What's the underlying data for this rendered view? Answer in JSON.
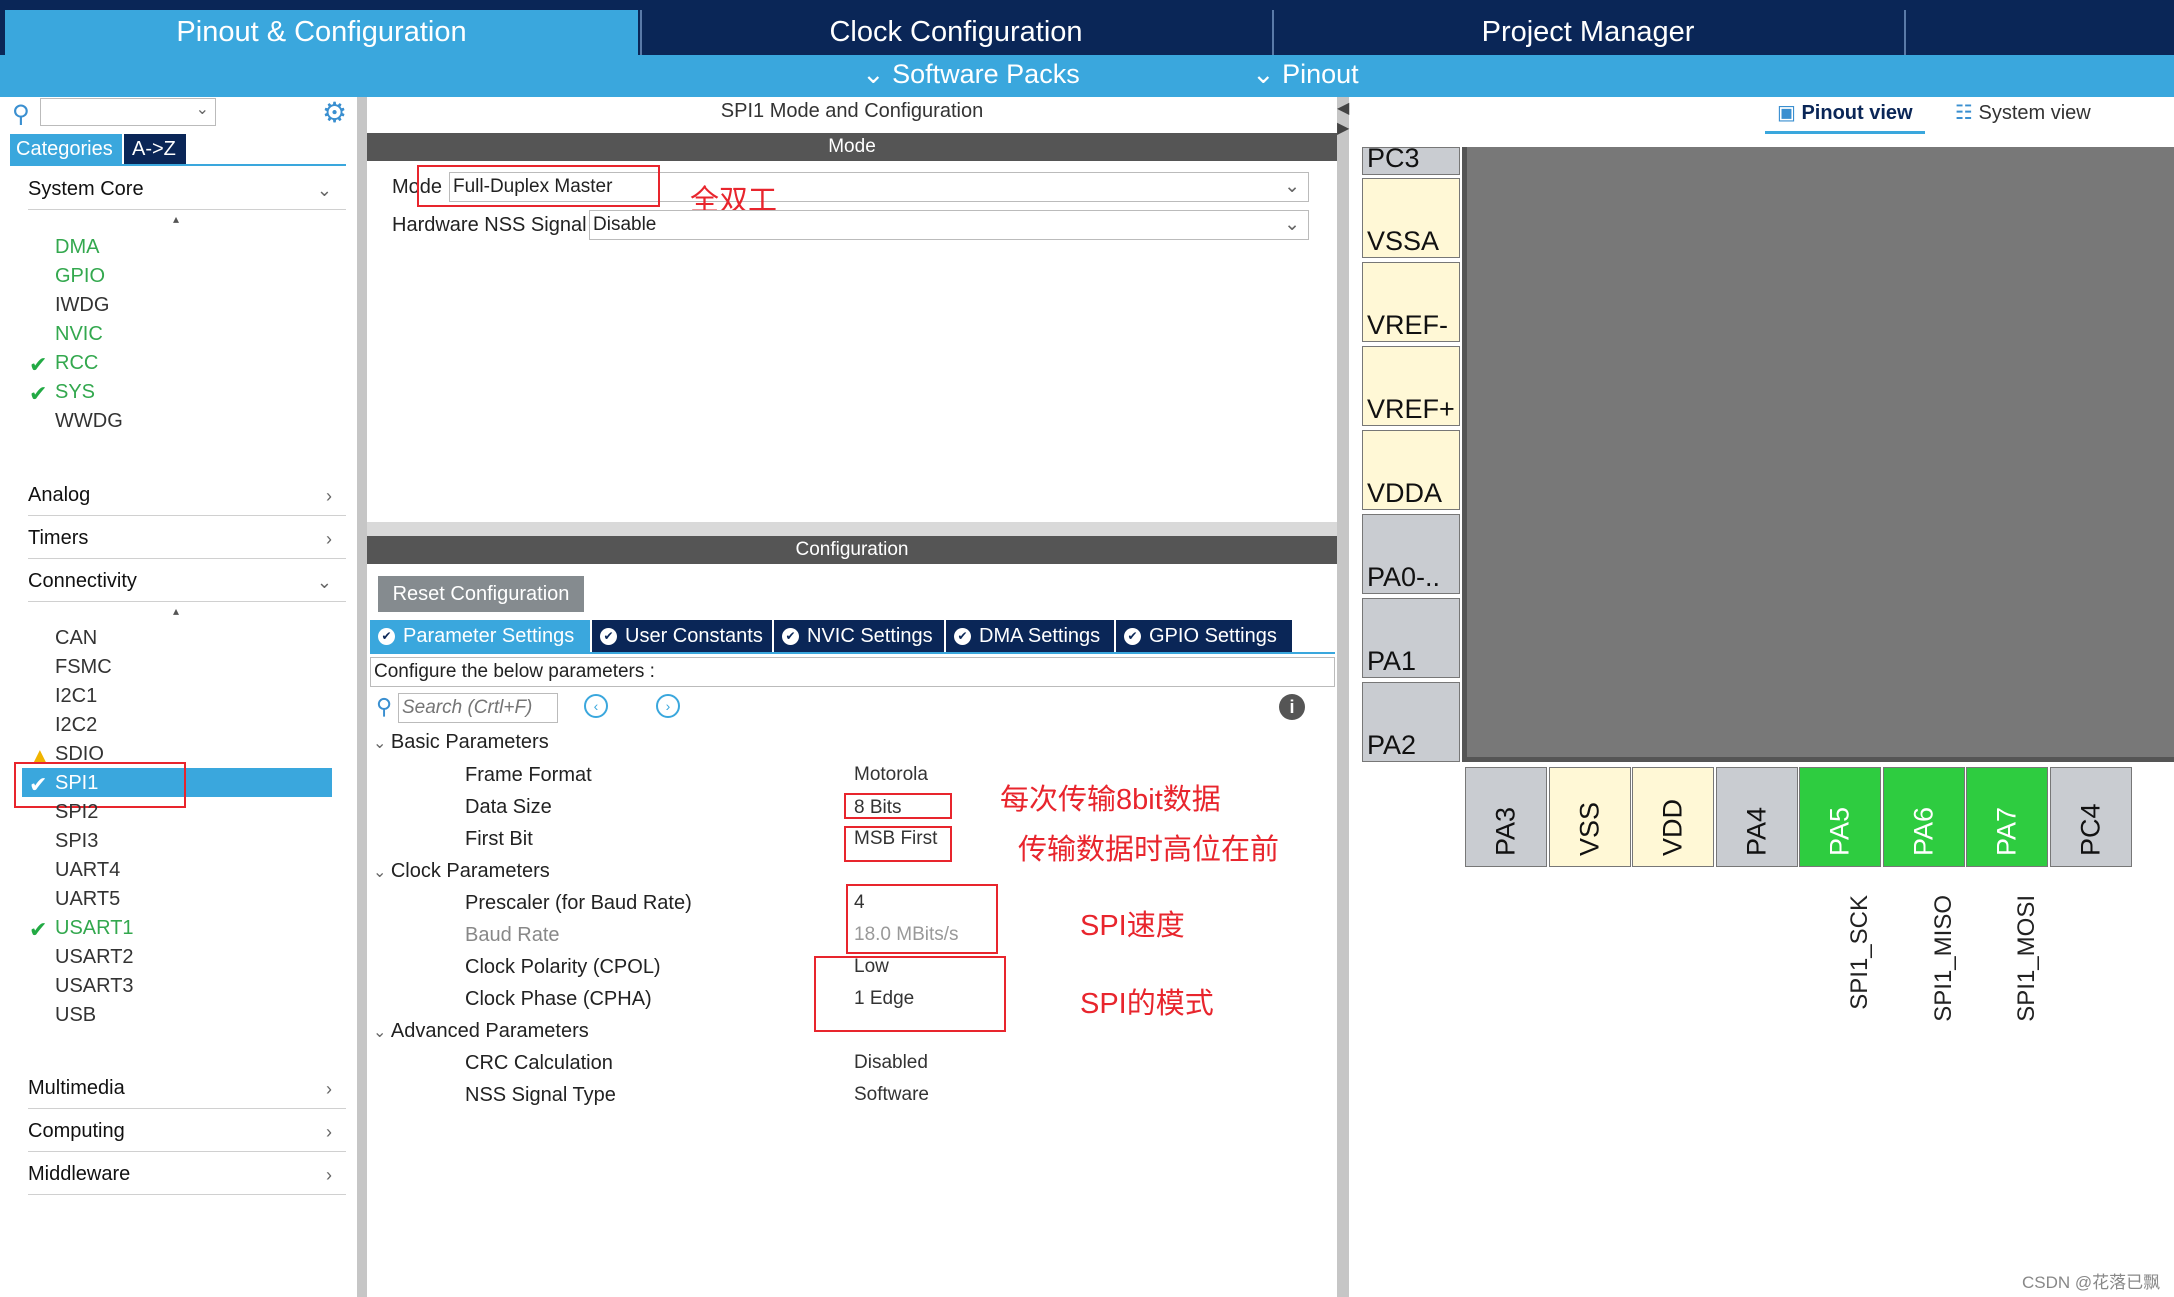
{
  "topnav": {
    "tabs": [
      "Pinout & Configuration",
      "Clock Configuration",
      "Project Manager"
    ],
    "sub": [
      "Software Packs",
      "Pinout"
    ]
  },
  "left": {
    "tabs": [
      "Categories",
      "A->Z"
    ],
    "groups": {
      "system_core": "System Core",
      "analog": "Analog",
      "timers": "Timers",
      "connectivity": "Connectivity",
      "multimedia": "Multimedia",
      "computing": "Computing",
      "middleware": "Middleware"
    },
    "system_core_items": [
      "DMA",
      "GPIO",
      "IWDG",
      "NVIC",
      "RCC",
      "SYS",
      "WWDG"
    ],
    "connectivity_items": [
      "CAN",
      "FSMC",
      "I2C1",
      "I2C2",
      "SDIO",
      "SPI1",
      "SPI2",
      "SPI3",
      "UART4",
      "UART5",
      "USART1",
      "USART2",
      "USART3",
      "USB"
    ]
  },
  "mid": {
    "title": "SPI1 Mode and Configuration",
    "mode_header": "Mode",
    "mode_label": "Mode",
    "mode_value": "Full-Duplex Master",
    "nss_label": "Hardware NSS Signal",
    "nss_value": "Disable",
    "config_header": "Configuration",
    "reset_button": "Reset Configuration",
    "tabs": [
      "Parameter Settings",
      "User Constants",
      "NVIC Settings",
      "DMA Settings",
      "GPIO Settings"
    ],
    "configure_text": "Configure the below parameters :",
    "search_placeholder": "Search (Crtl+F)",
    "sections": {
      "basic": "Basic Parameters",
      "clock": "Clock Parameters",
      "advanced": "Advanced Parameters"
    },
    "params": [
      {
        "label": "Frame Format",
        "value": "Motorola"
      },
      {
        "label": "Data Size",
        "value": "8 Bits"
      },
      {
        "label": "First Bit",
        "value": "MSB First"
      },
      {
        "label": "Prescaler (for Baud Rate)",
        "value": "4"
      },
      {
        "label": "Baud Rate",
        "value": "18.0 MBits/s"
      },
      {
        "label": "Clock Polarity (CPOL)",
        "value": "Low"
      },
      {
        "label": "Clock Phase (CPHA)",
        "value": "1 Edge"
      },
      {
        "label": "CRC Calculation",
        "value": "Disabled"
      },
      {
        "label": "NSS Signal Type",
        "value": "Software"
      }
    ]
  },
  "annotations": {
    "full_duplex": "全双工",
    "data_8bit": "每次传输8bit数据",
    "msb_first": "传输数据时高位在前",
    "spi_speed": "SPI速度",
    "spi_mode": "SPI的模式"
  },
  "right": {
    "views": [
      "Pinout view",
      "System view"
    ],
    "left_pins": [
      "PC3",
      "VSSA",
      "VREF-",
      "VREF+",
      "VDDA",
      "PA0-..",
      "PA1",
      "PA2"
    ],
    "bottom_pins": [
      "PA3",
      "VSS",
      "VDD",
      "PA4",
      "PA5",
      "PA6",
      "PA7",
      "PC4"
    ],
    "signals": [
      "SPI1_SCK",
      "SPI1_MISO",
      "SPI1_MOSI"
    ],
    "watermark": "CSDN @花落已飘"
  }
}
